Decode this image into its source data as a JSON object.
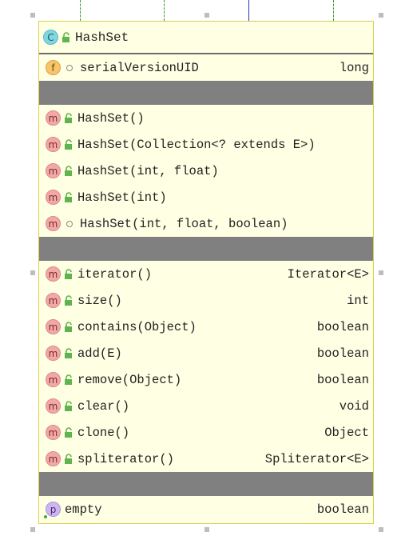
{
  "class": {
    "icon": "class-icon",
    "icon_letter": "C",
    "name": "HashSet"
  },
  "fields": [
    {
      "icon": "field-icon",
      "icon_letter": "f",
      "visibility": "package-private",
      "name": "serialVersionUID",
      "type": "long"
    }
  ],
  "constructors": [
    {
      "icon_letter": "m",
      "visibility": "public",
      "name": "HashSet()"
    },
    {
      "icon_letter": "m",
      "visibility": "public",
      "name": "HashSet(Collection<? extends E>)"
    },
    {
      "icon_letter": "m",
      "visibility": "public",
      "name": "HashSet(int, float)"
    },
    {
      "icon_letter": "m",
      "visibility": "public",
      "name": "HashSet(int)"
    },
    {
      "icon_letter": "m",
      "visibility": "package-private",
      "name": "HashSet(int, float, boolean)"
    }
  ],
  "methods": [
    {
      "icon_letter": "m",
      "visibility": "public",
      "name": "iterator()",
      "type": "Iterator<E>"
    },
    {
      "icon_letter": "m",
      "visibility": "public",
      "name": "size()",
      "type": "int"
    },
    {
      "icon_letter": "m",
      "visibility": "public",
      "name": "contains(Object)",
      "type": "boolean"
    },
    {
      "icon_letter": "m",
      "visibility": "public",
      "name": "add(E)",
      "type": "boolean"
    },
    {
      "icon_letter": "m",
      "visibility": "public",
      "name": "remove(Object)",
      "type": "boolean"
    },
    {
      "icon_letter": "m",
      "visibility": "public",
      "name": "clear()",
      "type": "void"
    },
    {
      "icon_letter": "m",
      "visibility": "public",
      "name": "clone()",
      "type": "Object"
    },
    {
      "icon_letter": "m",
      "visibility": "public",
      "name": "spliterator()",
      "type": "Spliterator<E>"
    }
  ],
  "properties": [
    {
      "icon": "property-icon",
      "icon_letter": "p",
      "name": "empty",
      "type": "boolean"
    }
  ],
  "colors": {
    "box_background": "#ffffe4",
    "box_border": "#d8cf4f",
    "separator": "#808080",
    "method_badge": "#f3a8a8",
    "class_badge": "#7fd6e0",
    "field_badge": "#f8c56a",
    "property_badge": "#cdb6ef",
    "lock_green": "#5fb44f"
  }
}
